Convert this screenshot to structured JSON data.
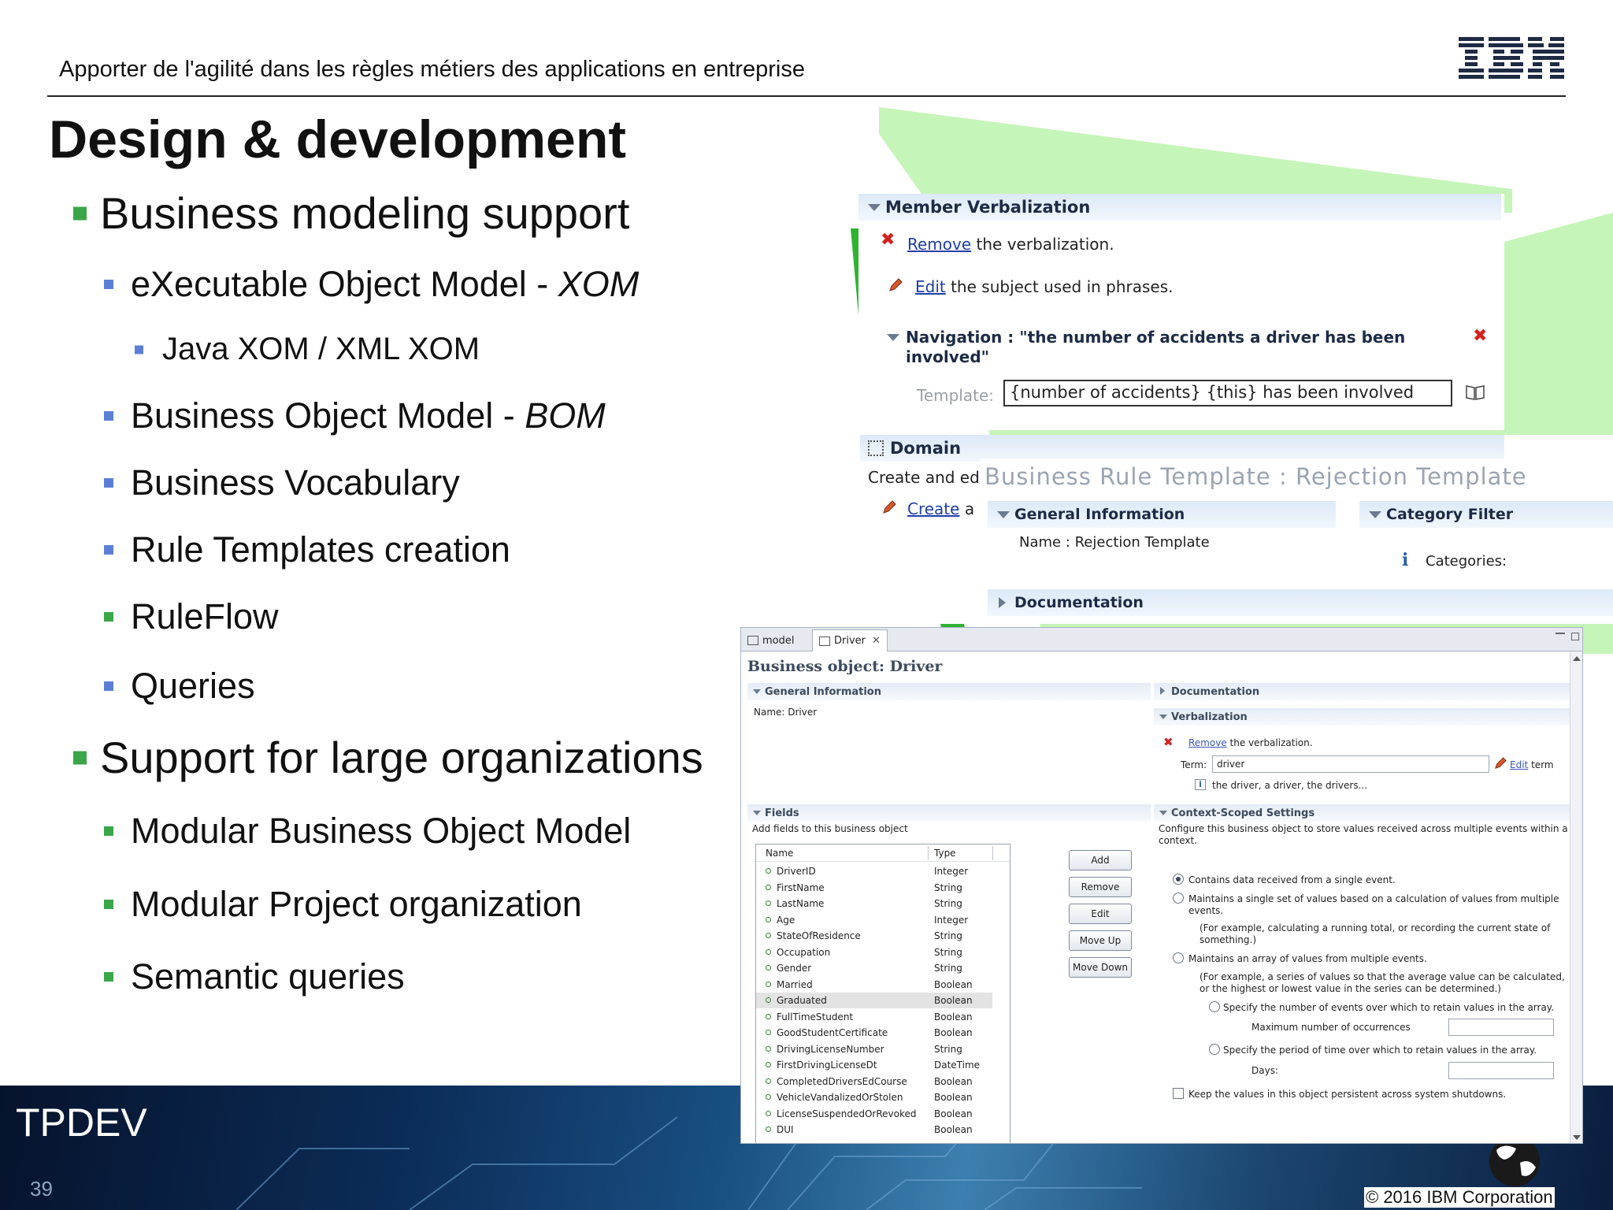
{
  "header": {
    "subtitle": "Apporter de l'agilité dans les règles métiers des applications en entreprise",
    "logo_text": "IBM"
  },
  "heading": "Design & development",
  "bullets": [
    {
      "level": 1,
      "text": "Business modeling support",
      "color": "#3aa649"
    },
    {
      "level": 2,
      "text": "eXecutable Object Model - ",
      "italic": "XOM",
      "color": "#5c7fd6"
    },
    {
      "level": 3,
      "text": "Java XOM / XML XOM",
      "color": "#5c7fd6"
    },
    {
      "level": 2,
      "text": "Business Object Model - ",
      "italic": "BOM",
      "color": "#5c7fd6"
    },
    {
      "level": 2,
      "text": "Business Vocabulary",
      "color": "#5c7fd6"
    },
    {
      "level": 2,
      "text": "Rule Templates creation",
      "color": "#5c7fd6"
    },
    {
      "level": 2,
      "text": "RuleFlow",
      "color": "#3aa649"
    },
    {
      "level": 2,
      "text": "Queries",
      "color": "#5c7fd6"
    },
    {
      "level": 1,
      "text": "Support for large organizations",
      "color": "#3aa649"
    },
    {
      "level": 2,
      "text": "Modular Business Object Model",
      "color": "#3aa649"
    },
    {
      "level": 2,
      "text": "Modular Project organization",
      "color": "#3aa649"
    },
    {
      "level": 2,
      "text": "Semantic queries",
      "color": "#3aa649"
    }
  ],
  "footer": {
    "brand": "TPDEV",
    "page_number": "39",
    "copyright": "© 2016 IBM Corporation"
  },
  "member_panel": {
    "section_title": "Member Verbalization",
    "remove_link": "Remove",
    "remove_rest": " the verbalization.",
    "edit_link": "Edit",
    "edit_rest": " the subject used in phrases.",
    "navigation_line1": "Navigation : \"the number of accidents a driver has been",
    "navigation_line2": "involved\"",
    "template_label": "Template:",
    "template_value": "{number of accidents} {this} has been involved"
  },
  "domain_panel": {
    "section_title": "Domain",
    "create_text": "Create and edi",
    "create_link": "Create",
    "create_rest": " a",
    "rule_template_title": "Business Rule Template : Rejection Template",
    "general_info": "General Information",
    "name_text": "Name :  Rejection Template",
    "category_filter": "Category Filter",
    "categories": "Categories:",
    "documentation": "Documentation"
  },
  "editor": {
    "tabs": [
      {
        "label": "model",
        "active": false
      },
      {
        "label": "Driver",
        "active": true,
        "close": "✕"
      }
    ],
    "title": "Business object: Driver",
    "general_info": "General Information",
    "name_label": "Name:  Driver",
    "documentation": "Documentation",
    "verbalization": "Verbalization",
    "remove_link": "Remove",
    "remove_rest": " the verbalization.",
    "term_label": "Term:",
    "term_value": "driver",
    "edit_link": "Edit",
    "edit_rest": " term",
    "forms_text": "the driver, a driver, the drivers...",
    "fields_title": "Fields",
    "fields_desc": "Add fields to this business object",
    "columns": [
      "Name",
      "Type"
    ],
    "fields": [
      {
        "name": "DriverID",
        "type": "Integer"
      },
      {
        "name": "FirstName",
        "type": "String"
      },
      {
        "name": "LastName",
        "type": "String"
      },
      {
        "name": "Age",
        "type": "Integer"
      },
      {
        "name": "StateOfResidence",
        "type": "String"
      },
      {
        "name": "Occupation",
        "type": "String"
      },
      {
        "name": "Gender",
        "type": "String"
      },
      {
        "name": "Married",
        "type": "Boolean"
      },
      {
        "name": "Graduated",
        "type": "Boolean",
        "selected": true
      },
      {
        "name": "FullTimeStudent",
        "type": "Boolean"
      },
      {
        "name": "GoodStudentCertificate",
        "type": "Boolean"
      },
      {
        "name": "DrivingLicenseNumber",
        "type": "String"
      },
      {
        "name": "FirstDrivingLicenseDt",
        "type": "DateTime"
      },
      {
        "name": "CompletedDriversEdCourse",
        "type": "Boolean"
      },
      {
        "name": "VehicleVandalizedOrStolen",
        "type": "Boolean"
      },
      {
        "name": "LicenseSuspendedOrRevoked",
        "type": "Boolean"
      },
      {
        "name": "DUI",
        "type": "Boolean"
      }
    ],
    "buttons": [
      "Add",
      "Remove",
      "Edit",
      "Move Up",
      "Move Down"
    ],
    "context_title": "Context-Scoped Settings",
    "context_desc1": "Configure this business object to store values received across multiple events within a",
    "context_desc2": "context.",
    "opt1": "Contains data received from a single event.",
    "opt2a": "Maintains a single set of values based on a calculation of values from multiple",
    "opt2b": "events.",
    "opt2c": "(For example, calculating a running total, or recording the current state of",
    "opt2d": "something.)",
    "opt3": "Maintains an array of values from multiple events.",
    "opt3a": "(For example, a series of values so that the average value can be calculated,",
    "opt3b": "or the highest or lowest value in the series can be determined.)",
    "sub1": "Specify the number of events over which to retain values in the array.",
    "max_label": "Maximum number of occurrences",
    "sub2": "Specify the period of time over which to retain values in the array.",
    "days_label": "Days:",
    "persist": "Keep the values in this object persistent across system shutdowns."
  }
}
